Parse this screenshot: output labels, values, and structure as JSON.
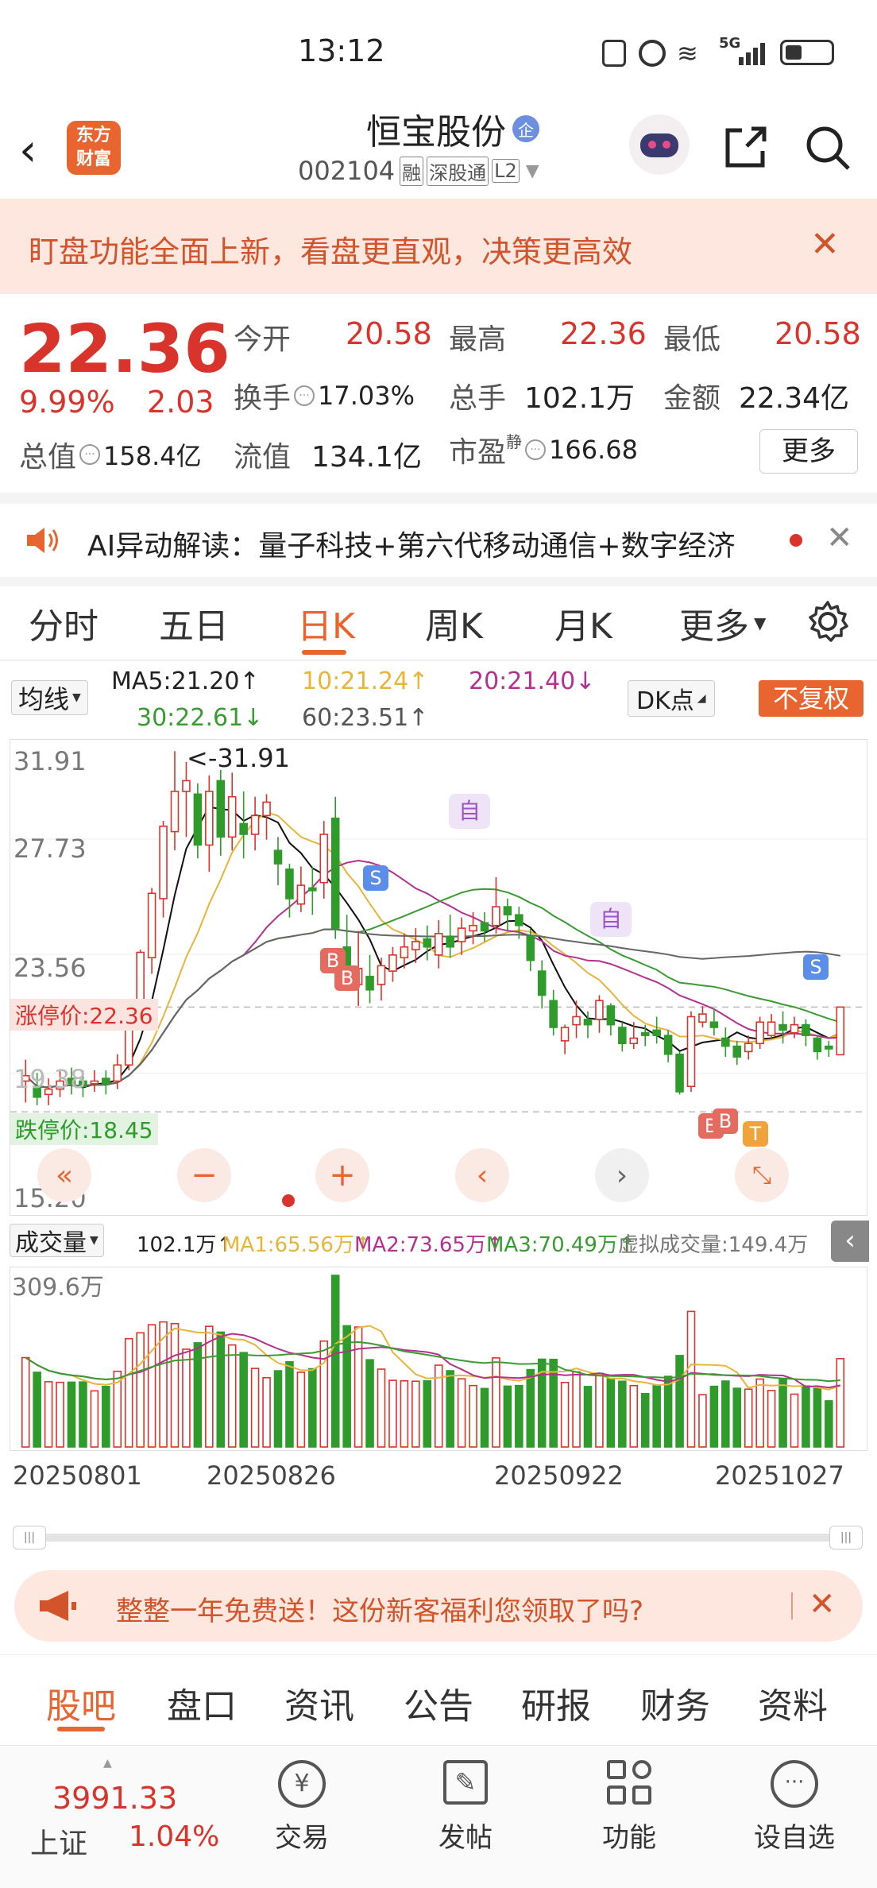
{
  "status_bar": {
    "time": "13:12",
    "network": "5G"
  },
  "header": {
    "logo_text_1": "东方",
    "logo_text_2": "财富",
    "stock_name": "恒宝股份",
    "ent_badge": "企",
    "stock_code": "002104",
    "tag_rong": "融",
    "tag_sgt": "深股通",
    "tag_l2": "L2"
  },
  "promo_banner": {
    "text": "盯盘功能全面上新，看盘更直观，决策更高效"
  },
  "quote": {
    "price": "22.36",
    "change_pct": "9.99%",
    "change_amt": "2.03",
    "open_label": "今开",
    "open_value": "20.58",
    "high_label": "最高",
    "high_value": "22.36",
    "low_label": "最低",
    "low_value": "20.58",
    "turnover_label": "换手",
    "turnover_value": "17.03%",
    "volume_label": "总手",
    "volume_value": "102.1万",
    "amount_label": "金额",
    "amount_value": "22.34亿",
    "mktcap_label": "总值",
    "mktcap_value": "158.4亿",
    "float_label": "流值",
    "float_value": "134.1亿",
    "pe_label": "市盈",
    "pe_sup": "静",
    "pe_value": "166.68",
    "more_button": "更多"
  },
  "ai_bar": {
    "text": "AI异动解读：量子科技+第六代移动通信+数字经济"
  },
  "chart_tabs": {
    "items": [
      "分时",
      "五日",
      "日K",
      "周K",
      "月K",
      "更多"
    ],
    "active": "日K"
  },
  "kline_header": {
    "ma_select": "均线",
    "ma5": "MA5:21.20↑",
    "ma10": "10:21.24↑",
    "ma20": "20:21.40↓",
    "ma30": "30:22.61↓",
    "ma60": "60:23.51↑",
    "dk_select": "DK点",
    "adjust": "不复权"
  },
  "price_axis": {
    "p1": "31.91",
    "p2": "27.73",
    "p3": "23.56",
    "p4": "19.38",
    "p5": "15.20"
  },
  "annotations": {
    "max_label": "<-31.91",
    "limit_up": "涨停价:22.36",
    "limit_down": "跌停价:18.45",
    "marker_zi": "自",
    "marker_s": "S",
    "marker_b": "B",
    "marker_t": "T"
  },
  "volume_header": {
    "select": "成交量",
    "vol": "102.1万↑",
    "ma1": "MA1:65.56万↑",
    "ma2": "MA2:73.65万↑",
    "ma3": "MA3:70.49万↑",
    "virtual": "虚拟成交量:149.4万",
    "max": "309.6万"
  },
  "date_axis": [
    "20250801",
    "20250826",
    "20250922",
    "20251027"
  ],
  "ad_banner": {
    "text": "整整一年免费送！这份新客福利您领取了吗?"
  },
  "sub_tabs": {
    "items": [
      "股吧",
      "盘口",
      "资讯",
      "公告",
      "研报",
      "财务",
      "资料"
    ],
    "active": "股吧"
  },
  "bottom_bar": {
    "index_value": "3991.33",
    "index_name": "上证",
    "index_change": "1.04%",
    "trade": "交易",
    "post": "发帖",
    "functions": "功能",
    "add_watch": "设自选"
  },
  "colors": {
    "up": "#d9342b",
    "down": "#2e9b2b",
    "accent": "#e8652f"
  },
  "chart_data": {
    "type": "candlestick",
    "ylim": [
      15.2,
      31.91
    ],
    "candles": [
      [
        19.6,
        19.8,
        20.4,
        18.8
      ],
      [
        19.4,
        19.0,
        19.9,
        18.7
      ],
      [
        19.1,
        19.3,
        19.7,
        18.7
      ],
      [
        19.3,
        19.6,
        20.0,
        19.0
      ],
      [
        19.7,
        19.5,
        20.1,
        19.1
      ],
      [
        19.6,
        19.4,
        20.0,
        19.0
      ],
      [
        19.5,
        19.6,
        20.0,
        19.2
      ],
      [
        19.7,
        19.5,
        20.0,
        19.1
      ],
      [
        19.6,
        20.2,
        20.6,
        19.3
      ],
      [
        20.2,
        22.2,
        22.3,
        20.0
      ],
      [
        22.0,
        24.4,
        24.5,
        21.8
      ],
      [
        24.2,
        26.6,
        26.8,
        23.6
      ],
      [
        26.4,
        29.1,
        29.3,
        25.7
      ],
      [
        28.9,
        30.4,
        31.9,
        28.2
      ],
      [
        30.4,
        30.8,
        31.5,
        28.7
      ],
      [
        30.3,
        28.4,
        30.7,
        27.9
      ],
      [
        28.4,
        30.4,
        31.0,
        27.4
      ],
      [
        30.8,
        28.7,
        31.2,
        28.0
      ],
      [
        28.7,
        30.2,
        31.1,
        28.2
      ],
      [
        29.2,
        28.8,
        30.4,
        27.9
      ],
      [
        28.8,
        29.5,
        30.2,
        28.2
      ],
      [
        29.5,
        30.0,
        30.3,
        28.6
      ],
      [
        28.2,
        27.7,
        28.7,
        26.9
      ],
      [
        27.5,
        26.4,
        27.7,
        25.7
      ],
      [
        26.2,
        26.9,
        27.6,
        25.9
      ],
      [
        26.8,
        26.7,
        27.6,
        25.8
      ],
      [
        27.0,
        28.8,
        29.3,
        26.4
      ],
      [
        29.4,
        25.3,
        30.2,
        24.9
      ],
      [
        24.6,
        23.5,
        25.8,
        23.0
      ],
      [
        23.2,
        23.8,
        25.2,
        22.4
      ],
      [
        23.5,
        23.0,
        24.3,
        22.5
      ],
      [
        23.2,
        23.9,
        24.2,
        22.6
      ],
      [
        23.7,
        24.3,
        24.6,
        23.3
      ],
      [
        24.2,
        24.6,
        25.1,
        23.8
      ],
      [
        24.5,
        24.8,
        25.3,
        24.0
      ],
      [
        24.9,
        24.6,
        25.4,
        24.1
      ],
      [
        24.3,
        25.1,
        25.6,
        23.8
      ],
      [
        25.0,
        24.6,
        25.8,
        24.2
      ],
      [
        24.8,
        25.3,
        25.7,
        24.3
      ],
      [
        25.2,
        25.4,
        25.9,
        24.7
      ],
      [
        25.5,
        25.2,
        25.9,
        24.8
      ],
      [
        25.4,
        26.1,
        27.2,
        25.1
      ],
      [
        26.1,
        25.8,
        26.4,
        25.2
      ],
      [
        25.8,
        25.4,
        26.1,
        24.9
      ],
      [
        25.0,
        24.1,
        25.3,
        23.7
      ],
      [
        23.7,
        22.8,
        24.1,
        22.3
      ],
      [
        22.6,
        21.6,
        23.0,
        21.3
      ],
      [
        21.1,
        21.6,
        21.7,
        20.6
      ],
      [
        21.7,
        22.0,
        22.6,
        21.2
      ],
      [
        21.9,
        21.7,
        22.2,
        21.2
      ],
      [
        21.9,
        22.6,
        22.8,
        21.4
      ],
      [
        22.4,
        21.7,
        22.5,
        21.3
      ],
      [
        21.6,
        21.0,
        21.8,
        20.7
      ],
      [
        21.0,
        21.2,
        21.8,
        20.8
      ],
      [
        21.4,
        21.3,
        21.7,
        20.9
      ],
      [
        21.5,
        21.3,
        22.0,
        21.0
      ],
      [
        21.3,
        20.6,
        21.5,
        20.3
      ],
      [
        20.6,
        19.2,
        20.7,
        19.1
      ],
      [
        19.4,
        22.0,
        22.2,
        19.2
      ],
      [
        21.8,
        22.1,
        22.4,
        21.6
      ],
      [
        21.8,
        21.6,
        22.3,
        21.3
      ],
      [
        21.2,
        20.9,
        21.6,
        20.5
      ],
      [
        20.9,
        20.5,
        21.1,
        20.2
      ],
      [
        20.7,
        21.0,
        21.3,
        20.4
      ],
      [
        21.0,
        21.8,
        22.0,
        20.8
      ],
      [
        21.3,
        21.8,
        22.1,
        21.2
      ],
      [
        21.7,
        21.5,
        22.2,
        21.0
      ],
      [
        21.4,
        21.7,
        22.0,
        21.2
      ],
      [
        21.7,
        21.3,
        21.9,
        20.9
      ],
      [
        21.2,
        20.7,
        21.3,
        20.4
      ],
      [
        20.9,
        20.8,
        21.1,
        20.5
      ],
      [
        20.58,
        22.36,
        22.36,
        20.58
      ]
    ],
    "volume_unit": "万",
    "volume_max": 309.6
  }
}
